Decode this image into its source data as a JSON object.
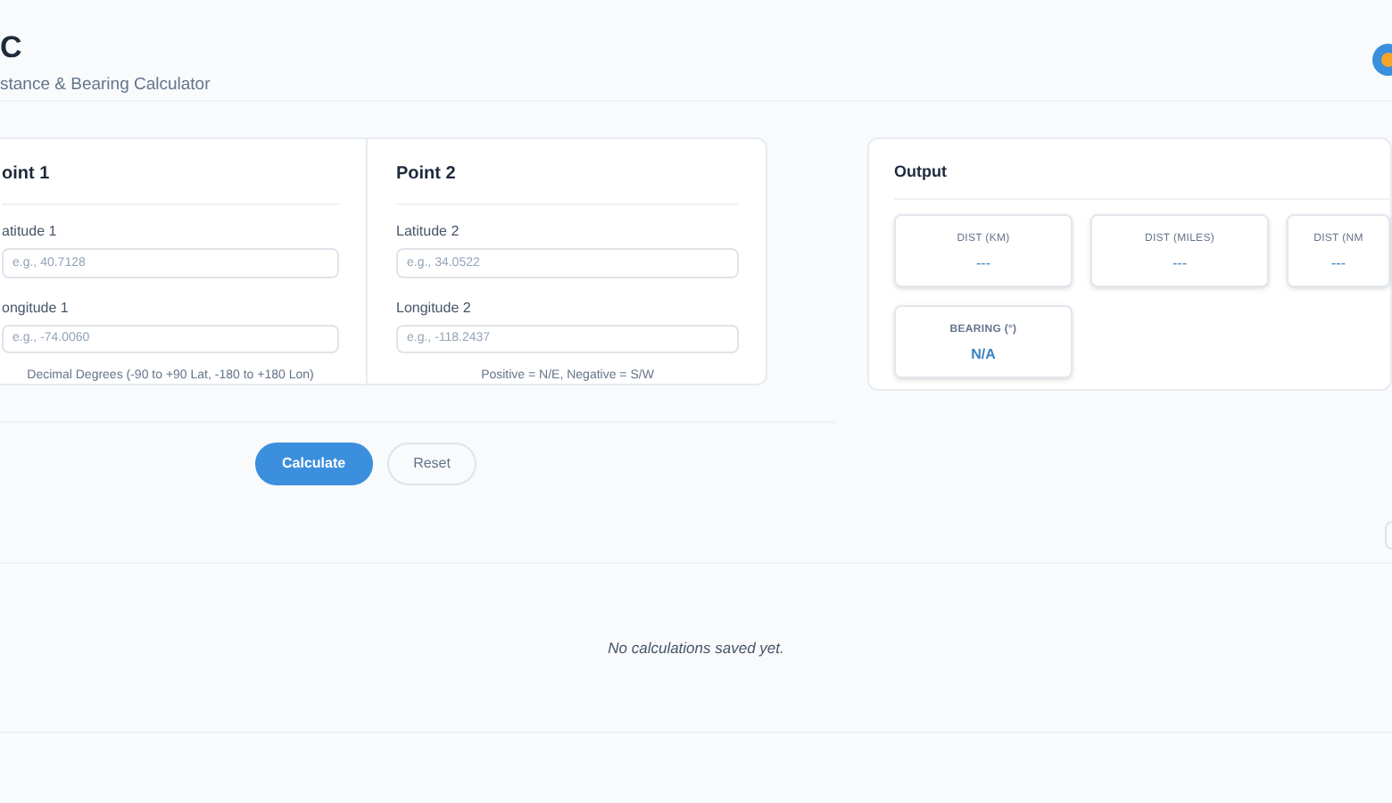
{
  "header": {
    "title": "C",
    "subtitle": "stance & Bearing Calculator"
  },
  "points": [
    {
      "heading": "oint 1",
      "fields": [
        {
          "label": "atitude 1",
          "placeholder": "e.g., 40.7128"
        },
        {
          "label": "ongitude 1",
          "placeholder": "e.g., -74.0060"
        }
      ],
      "hint": "Decimal Degrees (-90 to +90 Lat, -180 to +180 Lon)"
    },
    {
      "heading": "Point 2",
      "fields": [
        {
          "label": "Latitude 2",
          "placeholder": "e.g., 34.0522"
        },
        {
          "label": "Longitude 2",
          "placeholder": "e.g., -118.2437"
        }
      ],
      "hint": "Positive = N/E, Negative = S/W"
    }
  ],
  "buttons": [
    {
      "label": "Calculate",
      "kind": "primary"
    },
    {
      "label": "Reset",
      "kind": "secondary"
    }
  ],
  "output": {
    "title": "Output",
    "cards": [
      {
        "label": "DIST (KM)",
        "value": "---"
      },
      {
        "label": "DIST (MILES)",
        "value": "---"
      },
      {
        "label": "DIST (NM",
        "value": "---"
      },
      {
        "label": "BEARING (°)",
        "value": "N/A"
      }
    ]
  },
  "history": {
    "empty_text": "No calculations saved yet."
  }
}
